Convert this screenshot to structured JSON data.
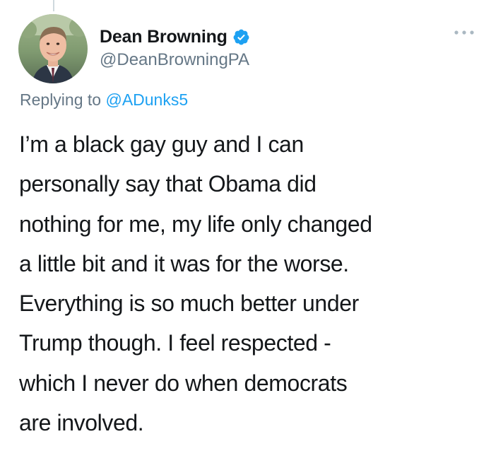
{
  "tweet": {
    "author": {
      "display_name": "Dean Browning",
      "handle": "@DeanBrowningPA",
      "verified": true,
      "verified_color": "#1da1f2"
    },
    "reply": {
      "prefix": "Replying to",
      "target": "@ADunks5"
    },
    "text_lines": [
      "I’m a black gay guy and I can",
      "personally say that Obama did",
      "nothing for me, my life only changed",
      "a little bit and it was for the worse.",
      "Everything is so much better under",
      "Trump though. I feel respected -",
      "which I never do when democrats",
      "are involved."
    ]
  },
  "icons": {
    "verified": "verified-badge-icon",
    "more": "more-options-icon"
  },
  "colors": {
    "text_primary": "#14171a",
    "text_secondary": "#657786",
    "link": "#1da1f2",
    "thread_line": "#cfd9de"
  }
}
